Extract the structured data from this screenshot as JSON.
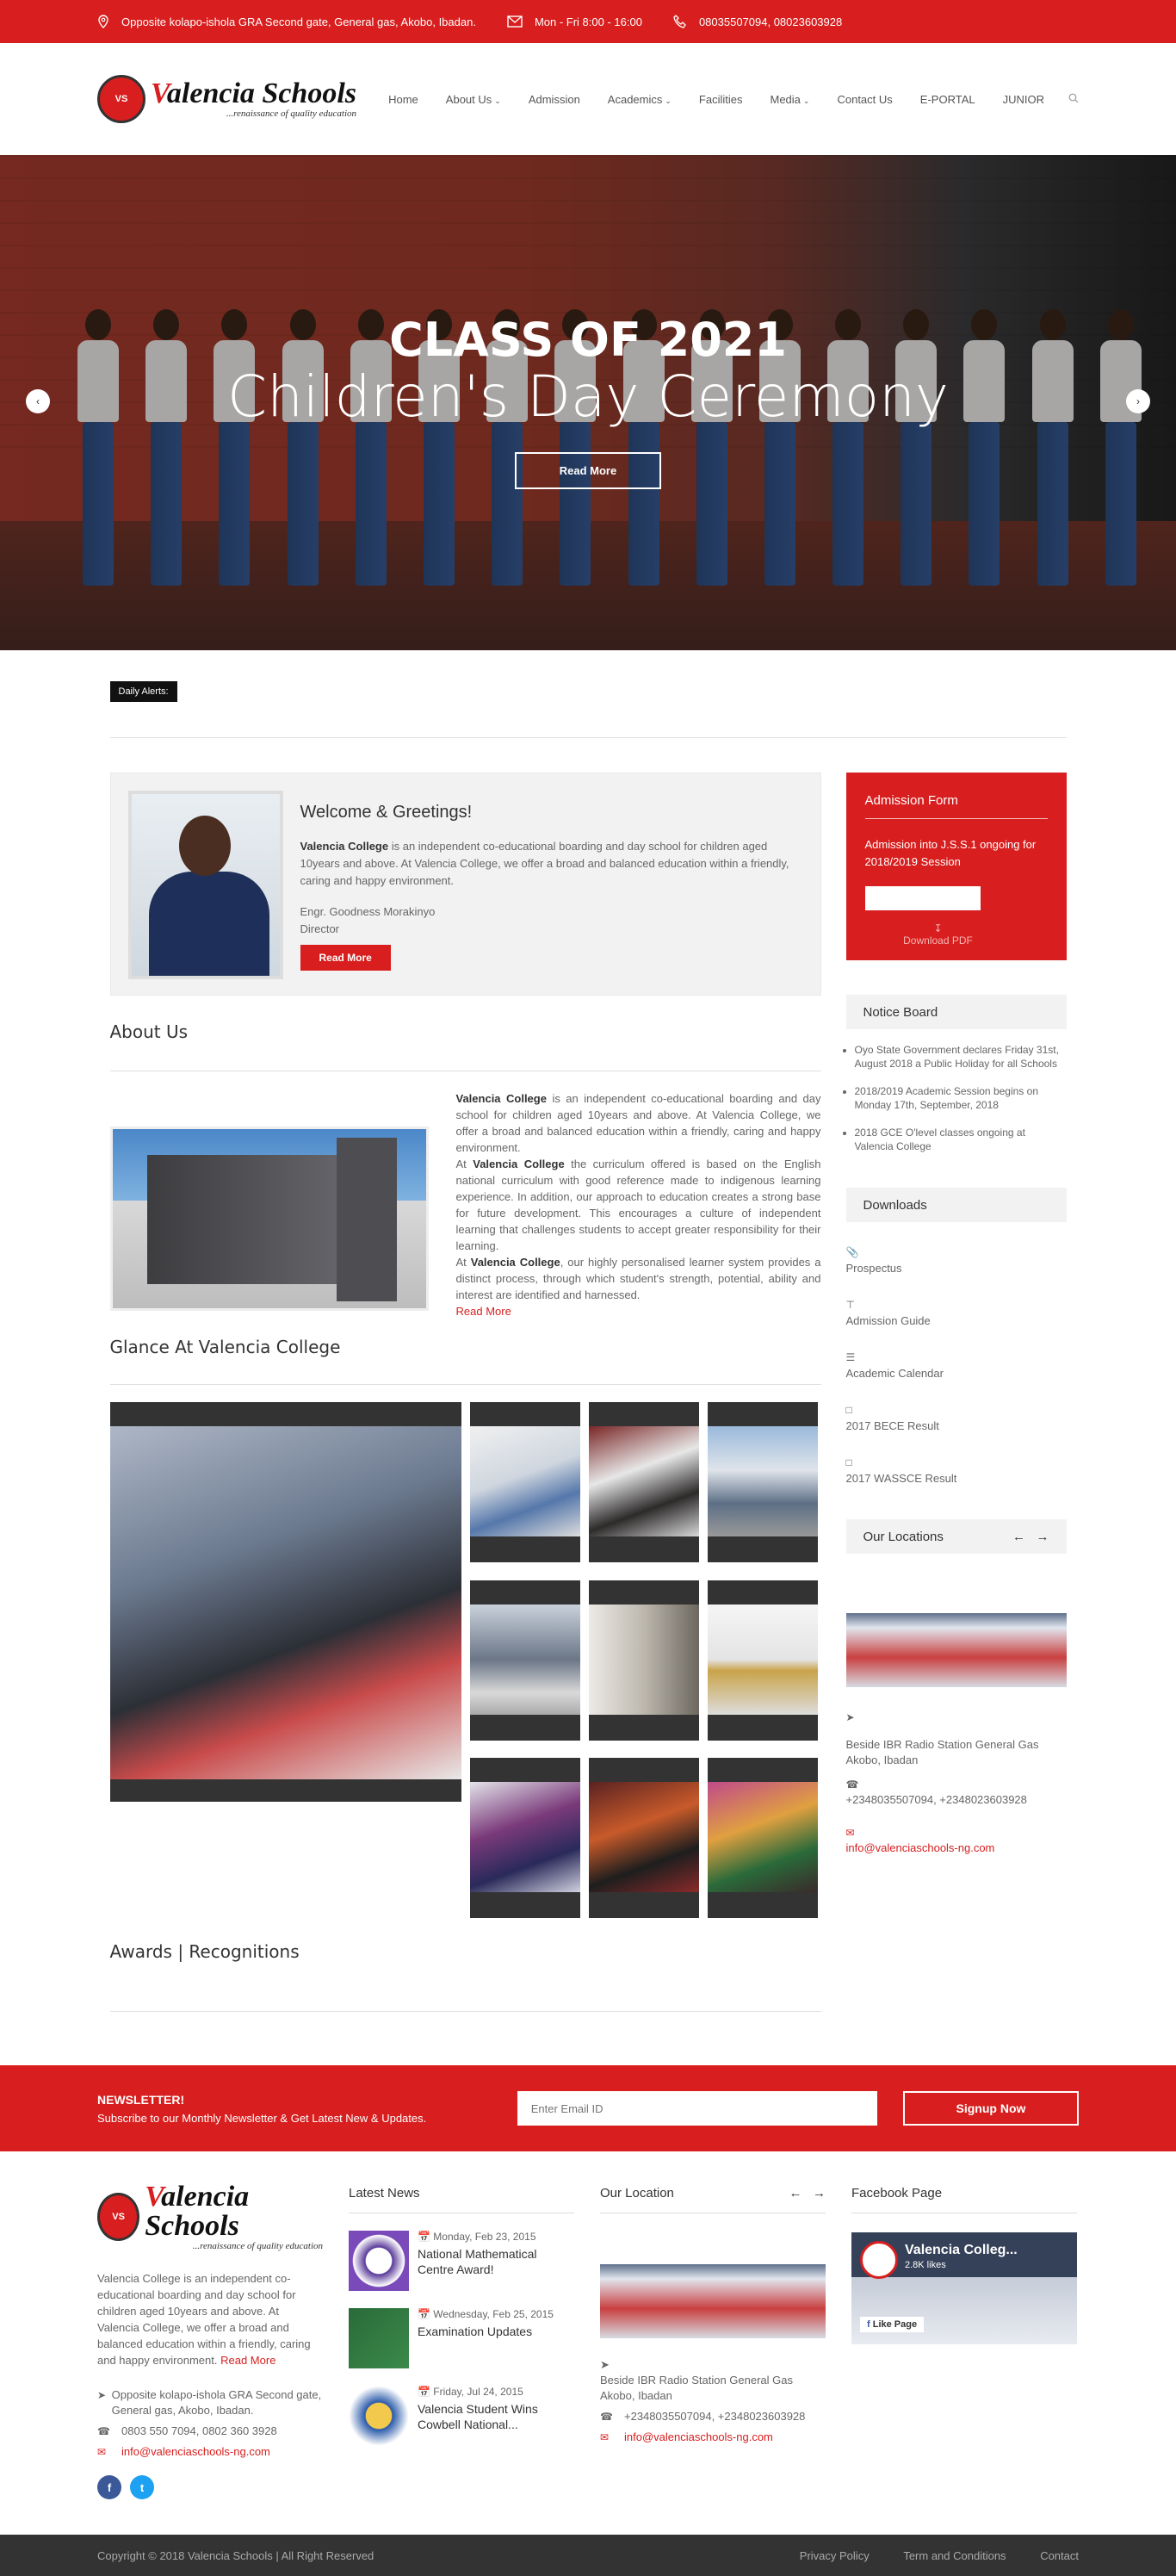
{
  "topbar": {
    "address": "Opposite kolapo-ishola GRA Second gate, General gas, Akobo, Ibadan.",
    "hours": "Mon - Fri 8:00 - 16:00",
    "phones": "08035507094, 08023603928"
  },
  "logo": {
    "name_v": "V",
    "name_rest": "alencia Schools",
    "tagline": "...renaissance of quality education"
  },
  "nav": {
    "items": [
      "Home",
      "About Us",
      "Admission",
      "Academics",
      "Facilities",
      "Media",
      "Contact Us",
      "E-PORTAL",
      "JUNIOR"
    ]
  },
  "hero": {
    "line1": "CLASS OF 2021",
    "line2": "Children's Day Ceremony",
    "button": "Read More"
  },
  "alerts": {
    "label": "Daily Alerts:"
  },
  "welcome": {
    "title": "Welcome & Greetings!",
    "bold": "Valencia College",
    "text": " is an independent co-educational boarding and day school for children aged 10years and above. At Valencia College, we offer a broad and balanced education within a friendly, caring and happy environment.",
    "name": "Engr. Goodness Morakinyo",
    "role": "Director",
    "button": "Read More"
  },
  "about": {
    "title": "About Us",
    "p1_bold": "Valencia College",
    "p1": " is an independent co-educational boarding and day school for children aged 10years and above. At Valencia College, we offer a broad and balanced education within a friendly, caring and happy environment.",
    "p2_pre": "At ",
    "p2_bold": "Valencia College",
    "p2": " the curriculum offered is based on the English national curriculum with good reference made to indigenous learning experience. In addition, our approach to education creates a strong base for future development. This encourages a culture of independent learning that challenges students to accept greater responsibility for their learning.",
    "p3_pre": "At ",
    "p3_bold": "Valencia College",
    "p3": ", our highly personalised learner system provides a distinct process, through which student's strength, potential, ability and interest are identified and harnessed.",
    "read_more": "Read More"
  },
  "glance": {
    "title": "Glance At Valencia College"
  },
  "awards": {
    "title": "Awards | Recognitions"
  },
  "admission": {
    "title": "Admission Form",
    "text": "Admission into J.S.S.1 ongoing for 2018/2019 Session",
    "download": "Download PDF"
  },
  "notice": {
    "title": "Notice Board",
    "items": [
      "Oyo State Government declares Friday 31st, August 2018 a Public Holiday for all Schools",
      "2018/2019 Academic Session begins on Monday 17th, September, 2018",
      "2018 GCE O'level classes ongoing at Valencia College"
    ]
  },
  "downloads": {
    "title": "Downloads",
    "items": [
      "Prospectus",
      "Admission Guide",
      "Academic Calendar",
      "2017 BECE Result",
      "2017 WASSCE Result"
    ]
  },
  "locations": {
    "title": "Our Locations",
    "address": "Beside IBR Radio Station General Gas Akobo, Ibadan",
    "phone": "+2348035507094, +2348023603928",
    "email": "info@valenciaschools-ng.com"
  },
  "newsletter": {
    "title": "NEWSLETTER!",
    "subtitle": "Subscribe to our Monthly Newsletter & Get Latest New & Updates.",
    "placeholder": "Enter Email ID",
    "button": "Signup Now"
  },
  "footer": {
    "about": "Valencia College is an independent co-educational boarding and day school for children aged 10years and above. At Valencia College, we offer a broad and balanced education within a friendly, caring and happy environment.",
    "read_more": "Read More",
    "address": "Opposite kolapo-ishola GRA Second gate, General gas, Akobo, Ibadan.",
    "phone": "0803 550 7094, 0802 360 3928",
    "email": "info@valenciaschools-ng.com",
    "latest_title": "Latest News",
    "news": [
      {
        "date": "Monday, Feb 23, 2015",
        "title": "National Mathematical Centre Award!"
      },
      {
        "date": "Wednesday, Feb 25, 2015",
        "title": "Examination Updates"
      },
      {
        "date": "Friday, Jul 24, 2015",
        "title": "Valencia Student Wins Cowbell National..."
      }
    ],
    "location_title": "Our Location",
    "loc_address": "Beside IBR Radio Station General Gas Akobo, Ibadan",
    "loc_phone": "+2348035507094, +2348023603928",
    "loc_email": "info@valenciaschools-ng.com",
    "fb_title": "Facebook Page",
    "fb_name": "Valencia Colleg...",
    "fb_likes": "2.8K likes",
    "fb_like": "Like Page"
  },
  "bottom": {
    "copyright": "Copyright © 2018 Valencia Schools | All Right Reserved",
    "links": [
      "Privacy Policy",
      "Term and Conditions",
      "Contact"
    ]
  },
  "colors": {
    "accent": "#d81e1e",
    "dark": "#333333"
  }
}
